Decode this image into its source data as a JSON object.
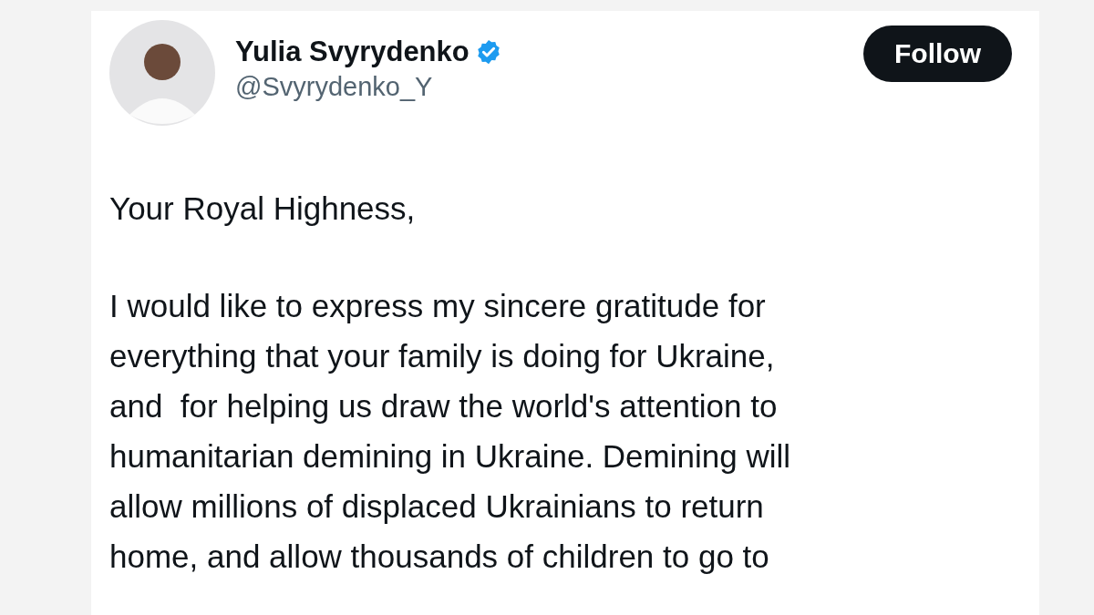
{
  "author": {
    "name": "Yulia Svyrydenko",
    "verified": true,
    "handle": "@Svyrydenko_Y"
  },
  "follow_button": {
    "label": "Follow"
  },
  "post": {
    "greeting": "Your Royal Highness,",
    "paragraph_lines": [
      "I would like to express my sincere gratitude for",
      "everything that your family is doing for Ukraine,",
      "and  for helping us draw the world's attention to",
      "humanitarian demining in Ukraine. Demining will",
      "allow millions of displaced Ukrainians to return",
      "home, and allow thousands of children to go to"
    ]
  }
}
